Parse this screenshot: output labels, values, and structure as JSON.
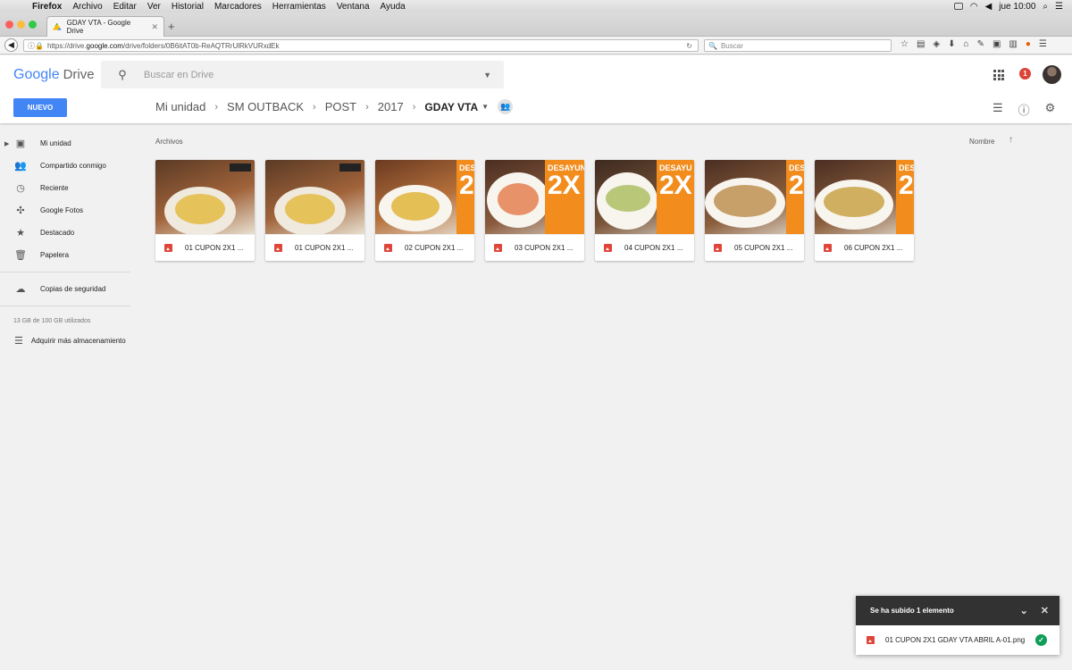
{
  "macos": {
    "menu": [
      "Firefox",
      "Archivo",
      "Editar",
      "Ver",
      "Historial",
      "Marcadores",
      "Herramientas",
      "Ventana",
      "Ayuda"
    ],
    "clock": "jue 10:00"
  },
  "browser": {
    "tab_title": "GDAY VTA - Google Drive",
    "url_prefix": "https://drive.",
    "url_domain": "google.com",
    "url_path": "/drive/folders/0B6itAT0b-ReAQTRrUlRkVURxdEk",
    "search_placeholder": "Buscar"
  },
  "drive": {
    "logo_google": "Google",
    "logo_drive": "Drive",
    "search_placeholder": "Buscar en Drive",
    "notifications": "1",
    "new_button": "NUEVO",
    "breadcrumb": [
      "Mi unidad",
      "SM OUTBACK",
      "POST",
      "2017"
    ],
    "current_folder": "GDAY VTA",
    "section_label": "Archivos",
    "sort_label": "Nombre"
  },
  "sidebar": {
    "items": [
      {
        "label": "Mi unidad",
        "icon": "drive-icon"
      },
      {
        "label": "Compartido conmigo",
        "icon": "people-icon"
      },
      {
        "label": "Reciente",
        "icon": "clock-icon"
      },
      {
        "label": "Google Fotos",
        "icon": "pinwheel-icon"
      },
      {
        "label": "Destacado",
        "icon": "star-icon"
      },
      {
        "label": "Papelera",
        "icon": "trash-icon"
      }
    ],
    "backups": "Copias de seguridad",
    "storage": "13 GB de 100 GB utilizados",
    "buy_storage": "Adquirir más almacenamiento"
  },
  "files": [
    {
      "name": "01 CUPON 2X1 ...",
      "banner": "",
      "big": "",
      "food": "#c98a2a"
    },
    {
      "name": "01 CUPON 2X1 ...",
      "banner": "",
      "big": "",
      "food": "#c98a2a"
    },
    {
      "name": "02 CUPON 2X1 ...",
      "banner": "DES",
      "big": "2",
      "food": "#d19a3a"
    },
    {
      "name": "03 CUPON 2X1 ...",
      "banner": "DESAYUN",
      "big": "2X",
      "food": "#e8926a"
    },
    {
      "name": "04 CUPON 2X1 ...",
      "banner": "DESAYU",
      "big": "2X",
      "food": "#9fb85a"
    },
    {
      "name": "05 CUPON 2X1 ...",
      "banner": "DES",
      "big": "2",
      "food": "#c7a069"
    },
    {
      "name": "06 CUPON 2X1 ...",
      "banner": "DES",
      "big": "2",
      "food": "#d0b060"
    }
  ],
  "upload_toast": {
    "title": "Se ha subido 1 elemento",
    "file": "01 CUPON 2X1 GDAY VTA ABRIL A-01.png"
  },
  "colors": {
    "accent": "#4285f4",
    "banner_orange": "#f28c1d",
    "notification_red": "#db4437",
    "success_green": "#0f9d58"
  }
}
